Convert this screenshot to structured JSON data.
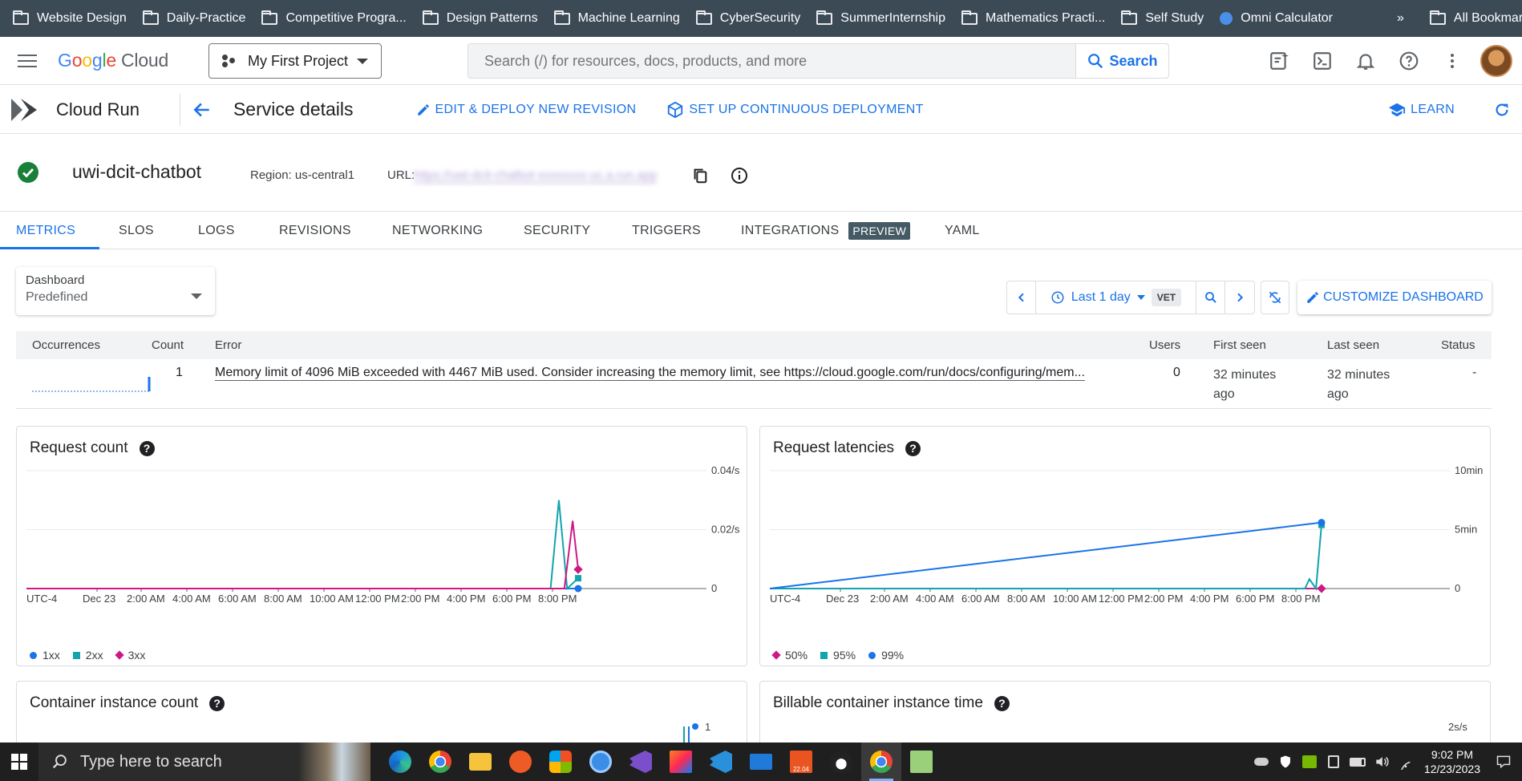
{
  "bookmarks": [
    "Website Design",
    "Daily-Practice",
    "Competitive Progra...",
    "Design Patterns",
    "Machine Learning",
    "CyberSecurity",
    "SummerInternship",
    "Mathematics Practi...",
    "Self Study",
    "Omni Calculator"
  ],
  "bookmarks_overflow": "»",
  "all_bookmarks": "All Bookmarks",
  "header": {
    "logo_parts": [
      "G",
      "o",
      "o",
      "g",
      "l",
      "e"
    ],
    "logo_cloud": "Cloud",
    "project": "My First Project",
    "search_placeholder": "Search (/) for resources, docs, products, and more",
    "search_button": "Search"
  },
  "subheader": {
    "product": "Cloud Run",
    "page_title": "Service details",
    "edit_deploy": "EDIT & DEPLOY NEW REVISION",
    "continuous": "SET UP CONTINUOUS DEPLOYMENT",
    "learn": "LEARN"
  },
  "service": {
    "name": "uwi-dcit-chatbot",
    "region": "Region: us-central1",
    "url_label": "URL:",
    "url_value": "https://uwi-dcit-chatbot-xxxxxxxx-uc.a.run.app"
  },
  "tabs": [
    "METRICS",
    "SLOS",
    "LOGS",
    "REVISIONS",
    "NETWORKING",
    "SECURITY",
    "TRIGGERS",
    "INTEGRATIONS",
    "YAML"
  ],
  "preview_badge": "PREVIEW",
  "dashboard": {
    "label": "Dashboard",
    "value": "Predefined",
    "time_range": "Last 1 day",
    "timezone": "VET",
    "customize": "CUSTOMIZE DASHBOARD"
  },
  "error_table": {
    "headers": [
      "Occurrences",
      "Count",
      "Error",
      "Users",
      "First seen",
      "Last seen",
      "Status"
    ],
    "row": {
      "count": "1",
      "error": "Memory limit of 4096 MiB exceeded with 4467 MiB used. Consider increasing the memory limit, see https://cloud.google.com/run/docs/configuring/mem...",
      "users": "0",
      "first_seen_1": "32 minutes",
      "first_seen_2": "ago",
      "last_seen_1": "32 minutes",
      "last_seen_2": "ago",
      "status": "-"
    }
  },
  "cards": {
    "request_count": "Request count",
    "request_latencies": "Request latencies",
    "container_instance_count": "Container instance count",
    "billable_time": "Billable container instance time",
    "help_glyph": "?"
  },
  "chart_data": [
    {
      "type": "line",
      "title": "Request count",
      "x_ticks": [
        "UTC-4",
        "Dec 23",
        "2:00 AM",
        "4:00 AM",
        "6:00 AM",
        "8:00 AM",
        "10:00 AM",
        "12:00 PM",
        "2:00 PM",
        "4:00 PM",
        "6:00 PM",
        "8:00 PM"
      ],
      "y_ticks": [
        "0.04/s",
        "0.02/s",
        "0"
      ],
      "ylim": [
        0,
        0.04
      ],
      "series": [
        {
          "name": "1xx",
          "color": "#1a73e8",
          "x": [
            0.0,
            0.99,
            1.0
          ],
          "values": [
            0,
            0,
            0
          ]
        },
        {
          "name": "2xx",
          "color": "#12a4af",
          "x": [
            0.0,
            0.95,
            0.965,
            0.98,
            1.0
          ],
          "values": [
            0,
            0,
            0.03,
            0.0,
            0.0035
          ]
        },
        {
          "name": "3xx",
          "color": "#d01884",
          "x": [
            0.0,
            0.975,
            0.99,
            1.0
          ],
          "values": [
            0,
            0,
            0.023,
            0.0065
          ]
        }
      ],
      "grid": true,
      "legend": "bottom-left"
    },
    {
      "type": "line",
      "title": "Request latencies",
      "x_ticks": [
        "UTC-4",
        "Dec 23",
        "2:00 AM",
        "4:00 AM",
        "6:00 AM",
        "8:00 AM",
        "10:00 AM",
        "12:00 PM",
        "2:00 PM",
        "4:00 PM",
        "6:00 PM",
        "8:00 PM"
      ],
      "y_ticks": [
        "10min",
        "5min",
        "0"
      ],
      "ylim": [
        0,
        10
      ],
      "series": [
        {
          "name": "50%",
          "color": "#d01884",
          "x": [
            0.0,
            1.0
          ],
          "values": [
            0,
            0
          ]
        },
        {
          "name": "95%",
          "color": "#12a4af",
          "x": [
            0.0,
            0.97,
            0.978,
            0.99,
            1.0
          ],
          "values": [
            0,
            0,
            0.8,
            0,
            5.4
          ]
        },
        {
          "name": "99%",
          "color": "#1a73e8",
          "x": [
            0.0,
            1.0
          ],
          "values": [
            0,
            5.6
          ]
        }
      ],
      "grid": true,
      "legend": "bottom-left"
    },
    {
      "type": "line",
      "title": "Container instance count",
      "y_ticks": [
        "1"
      ],
      "partial": true
    },
    {
      "type": "line",
      "title": "Billable container instance time",
      "y_ticks": [
        "2s/s"
      ],
      "partial": true
    }
  ],
  "taskbar": {
    "search_placeholder": "Type here to search",
    "time": "9:02 PM",
    "date": "12/23/2023",
    "badge": "22.04"
  }
}
